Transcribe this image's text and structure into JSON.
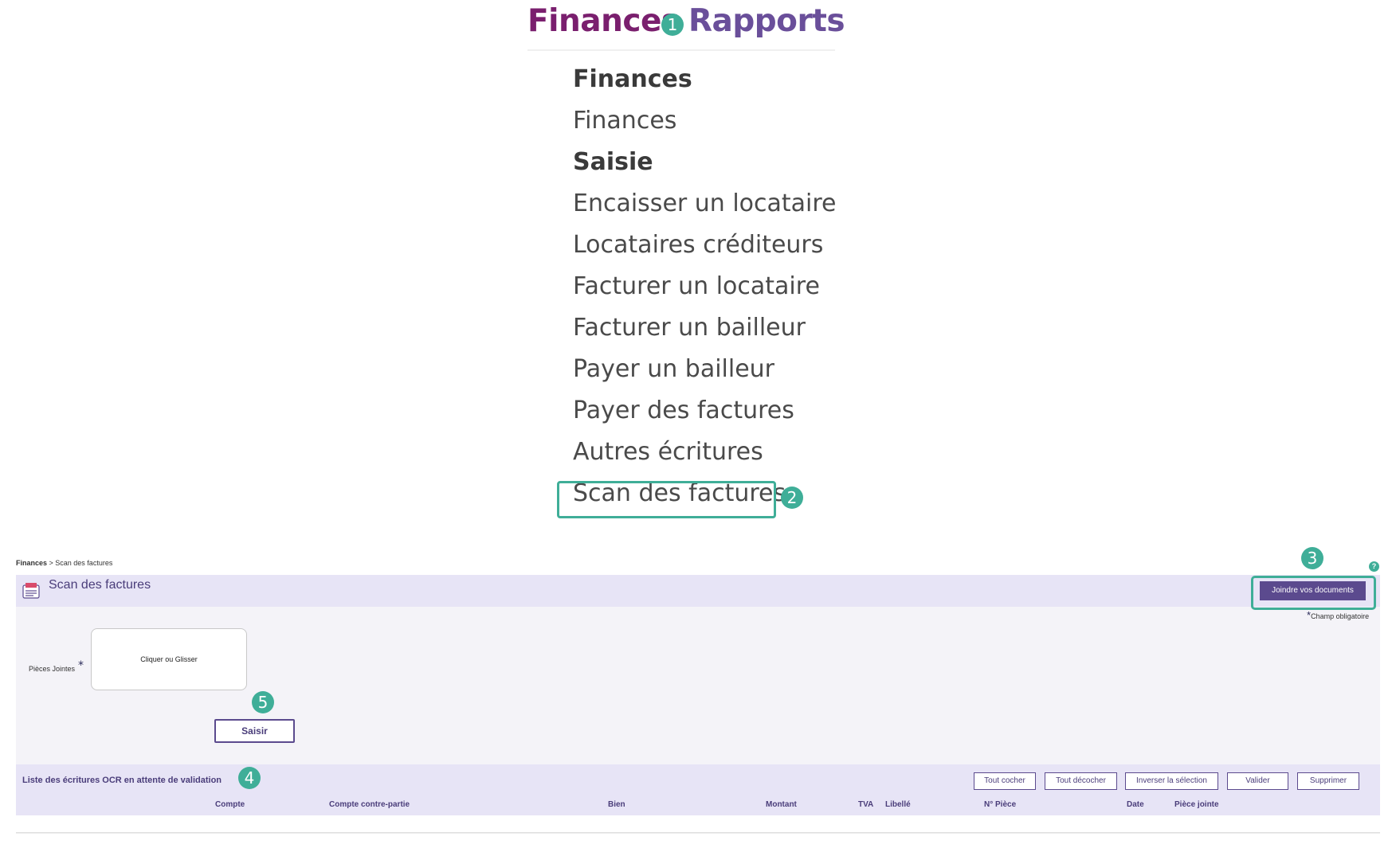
{
  "nav": {
    "tabs": [
      "Finances",
      "Rapports"
    ],
    "callout": "1"
  },
  "menu": {
    "items": [
      {
        "label": "Finances",
        "heading": true
      },
      {
        "label": "Finances",
        "heading": false
      },
      {
        "label": "Saisie",
        "heading": true
      },
      {
        "label": "Encaisser un locataire",
        "heading": false
      },
      {
        "label": "Locataires créditeurs",
        "heading": false
      },
      {
        "label": "Facturer un locataire",
        "heading": false
      },
      {
        "label": "Facturer un bailleur",
        "heading": false
      },
      {
        "label": "Payer un bailleur",
        "heading": false
      },
      {
        "label": "Payer des factures",
        "heading": false
      },
      {
        "label": "Autres écritures",
        "heading": false
      },
      {
        "label": "Scan des factures",
        "heading": false
      }
    ],
    "callout": "2"
  },
  "page": {
    "breadcrumb": {
      "root": "Finances",
      "separator": " > ",
      "current": "Scan des factures"
    },
    "title": "Scan des factures",
    "icon": "ocr-icon",
    "help_symbol": "?",
    "join_button": "Joindre vos documents",
    "join_callout": "3",
    "required_star": "*",
    "required_note": "Champ obligatoire",
    "attachments_label": "Pièces Jointes",
    "attachments_star": "*",
    "dropzone_text": "Cliquer ou Glisser",
    "saisir_callout": "5",
    "saisir_button": "Saisir"
  },
  "list": {
    "title": "Liste des écritures OCR en attente de validation",
    "callout": "4",
    "buttons": [
      "Tout cocher",
      "Tout décocher",
      "Inverser la sélection",
      "Valider",
      "Supprimer"
    ],
    "columns": [
      "Compte",
      "Compte contre-partie",
      "Bien",
      "Montant",
      "TVA",
      "Libellé",
      "N° Pièce",
      "Date",
      "Pièce jointe"
    ]
  },
  "colors": {
    "accent_teal": "#3fae98",
    "brand_purple": "#5b4a8e",
    "finances_tab": "#7a1f6e",
    "rapports_tab": "#6a4f9a",
    "title_bar": "#e7e4f6"
  }
}
